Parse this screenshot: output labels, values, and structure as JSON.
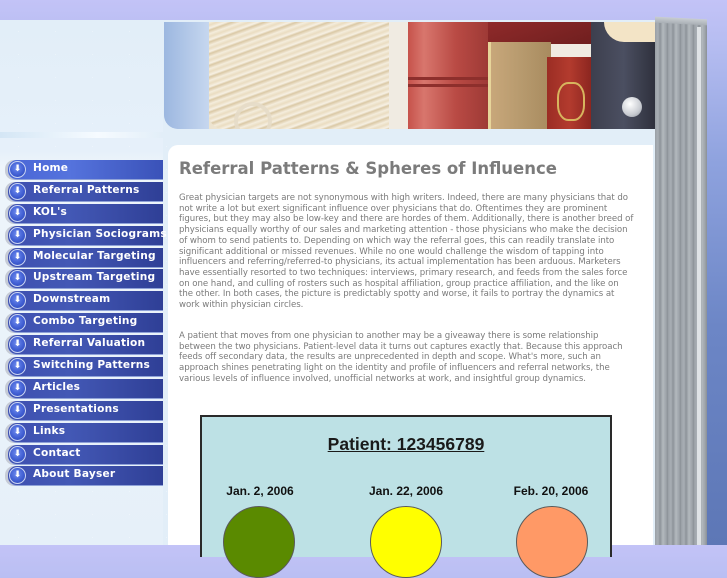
{
  "nav": {
    "items": [
      {
        "label": "Home",
        "icon": "arrow-down-circle-icon",
        "active": true
      },
      {
        "label": "Referral Patterns",
        "icon": "arrow-down-circle-icon"
      },
      {
        "label": "KOL's",
        "icon": "arrow-down-circle-icon"
      },
      {
        "label": "Physician Sociograms",
        "icon": "arrow-down-circle-icon"
      },
      {
        "label": "Molecular Targeting",
        "icon": "arrow-down-circle-icon"
      },
      {
        "label": "Upstream Targeting",
        "icon": "arrow-down-circle-icon"
      },
      {
        "label": "Downstream",
        "icon": "arrow-down-circle-icon"
      },
      {
        "label": "Combo Targeting",
        "icon": "arrow-down-circle-icon"
      },
      {
        "label": "Referral Valuation",
        "icon": "arrow-down-circle-icon"
      },
      {
        "label": "Switching Patterns",
        "icon": "arrow-down-circle-icon"
      },
      {
        "label": "Articles",
        "icon": "arrow-down-circle-icon"
      },
      {
        "label": "Presentations",
        "icon": "arrow-down-circle-icon"
      },
      {
        "label": "Links",
        "icon": "arrow-down-circle-icon"
      },
      {
        "label": "Contact",
        "icon": "arrow-down-circle-icon"
      },
      {
        "label": "About Bayser",
        "icon": "arrow-down-circle-icon"
      }
    ],
    "icon_glyph": "⬇"
  },
  "main": {
    "title": "Referral Patterns & Spheres of Influence",
    "paragraphs": [
      "Great physician targets are not synonymous with high writers. Indeed, there are many physicians that do not write a lot but exert significant influence over physicians that do. Oftentimes they are prominent figures, but they may also be low-key and there are hordes of them. Additionally, there is another breed of physicians equally worthy of our sales and marketing attention - those physicians who make the decision of whom to send patients to.  Depending on which way the referral goes, this can readily translate into significant additional or missed revenues. While no one would challenge the wisdom of tapping into influencers and referring/referred-to physicians, its actual implementation has been arduous. Marketers have essentially resorted to two techniques: interviews, primary research, and feeds from the sales force on one hand, and culling of rosters such as hospital affiliation, group practice affiliation, and the like on the other. In both cases, the picture is predictably spotty and worse, it fails to portray the dynamics at work within physician circles.",
      "A patient that moves from one physician to another may be a giveaway there is some relationship between the two physicians. Patient-level data it turns out captures exactly that. Because this approach feeds off secondary data, the results are unprecedented in depth and scope. What's more, such an approach shines penetrating light on the identity and profile of influencers and referral networks, the various levels of influence involved, unofficial networks at work, and insightful group dynamics."
    ],
    "figure": {
      "title": "Patient: 123456789",
      "visits": [
        {
          "date": "Jan. 2, 2006",
          "color": "#5a8a00"
        },
        {
          "date": "Jan. 22, 2006",
          "color": "#ffff00"
        },
        {
          "date": "Feb. 20, 2006",
          "color": "#ff9966"
        }
      ]
    }
  }
}
